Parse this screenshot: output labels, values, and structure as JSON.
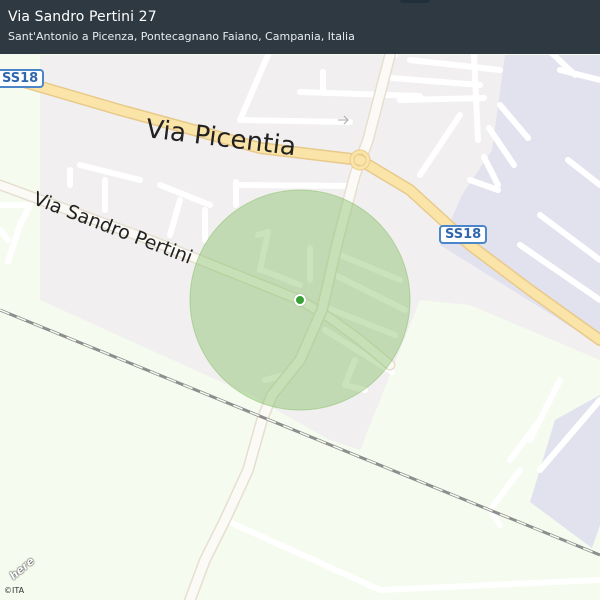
{
  "location": {
    "title": "Via Sandro Pertini 27",
    "address": "Sant'Antonio a Picenza, Pontecagnano Faiano, Campania, Italia"
  },
  "map": {
    "road_labels": {
      "main": "Via  Picentia",
      "secondary": "Via  Sandro  Pertini"
    },
    "shields": {
      "left": "SS18",
      "right": "SS18"
    },
    "accuracy_circle_color": "#8ac16a",
    "marker_color": "#3aa03a",
    "highway_color": "#fbe4a8",
    "industrial_color": "#e2e2ee",
    "urban_color": "#f1eff0"
  },
  "attribution": {
    "logo": "here",
    "copyright": "©ITA"
  }
}
